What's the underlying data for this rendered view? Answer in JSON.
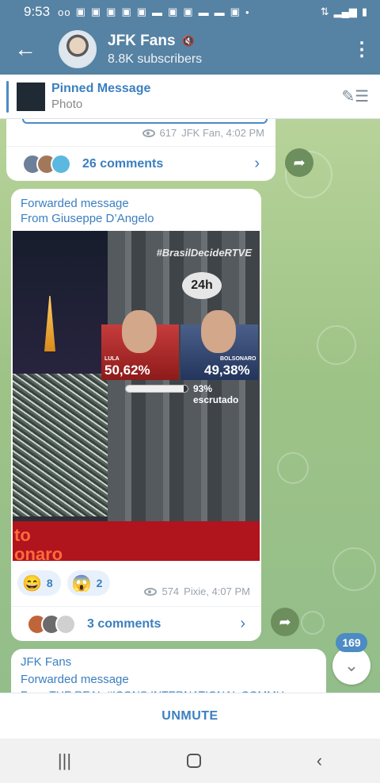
{
  "status_bar": {
    "time": "9:53"
  },
  "header": {
    "channel_name": "JFK Fans",
    "subscribers": "8.8K subscribers",
    "back_icon": "arrow-left-icon",
    "more_icon": "more-vert-icon"
  },
  "pinned": {
    "title": "Pinned Message",
    "subtitle": "Photo"
  },
  "messages": [
    {
      "views": "617",
      "author_time": "JFK Fan, 4:02 PM",
      "comments": "26 comments"
    },
    {
      "forwarded_label": "Forwarded message",
      "forwarded_from": "From Giuseppe D’Angelo",
      "image": {
        "hashtag": "#BrasilDecideRTVE",
        "bubble": "24h",
        "left_name": "LULA",
        "left_pct": "50,62%",
        "right_name": "BOLSONARO",
        "right_pct": "49,38%",
        "progress_label": "93% escrutado",
        "progress_value": 0.93,
        "red_text_1": "to",
        "red_text_2": "onaro"
      },
      "reactions": [
        {
          "emoji": "😄",
          "count": "8"
        },
        {
          "emoji": "😱",
          "count": "2"
        }
      ],
      "views": "574",
      "author_time": "Pixie, 4:07 PM",
      "comments": "3 comments"
    },
    {
      "channel": "JFK Fans",
      "forwarded_label": "Forwarded message",
      "forwarded_from": "From THE REAL #ICONS INTERNATIONAL COMMU"
    }
  ],
  "unread_badge": "169",
  "unmute_label": "UNMUTE",
  "nav": {
    "recents_icon": "recents-icon",
    "home_icon": "home-icon",
    "back_icon": "back-chevron-icon"
  }
}
